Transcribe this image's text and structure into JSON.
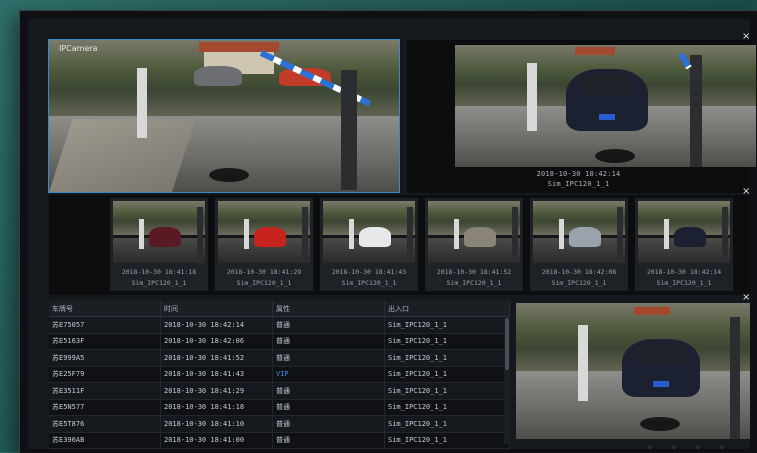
{
  "main_view": {
    "watermark": "IPCamera"
  },
  "snapshot_top": {
    "timestamp": "2018-10-30 18:42:14",
    "camera": "Sim_IPC120_1_1",
    "close_label": "×"
  },
  "thumbnails": [
    {
      "timestamp": "2018-10-30 18:41:18",
      "camera": "Sim_IPC120_1_1",
      "car_color": "#5a1a24"
    },
    {
      "timestamp": "2018-10-30 18:41:29",
      "camera": "Sim_IPC120_1_1",
      "car_color": "#c8241e"
    },
    {
      "timestamp": "2018-10-30 18:41:43",
      "camera": "Sim_IPC120_1_1",
      "car_color": "#e6e8ea"
    },
    {
      "timestamp": "2018-10-30 18:41:52",
      "camera": "Sim_IPC120_1_1",
      "car_color": "#8a8478"
    },
    {
      "timestamp": "2018-10-30 18:42:08",
      "camera": "Sim_IPC120_1_1",
      "car_color": "#9aa2ac"
    },
    {
      "timestamp": "2018-10-30 18:42:14",
      "camera": "Sim_IPC120_1_1",
      "car_color": "#1b2130"
    }
  ],
  "thumb_close_label": "×",
  "table": {
    "headers": [
      "车牌号",
      "时间",
      "属性",
      "出入口"
    ],
    "rows": [
      [
        "苏E75057",
        "2018-10-30 18:42:14",
        "普通",
        "Sim_IPC120_1_1"
      ],
      [
        "苏E5163F",
        "2018-10-30 18:42:06",
        "普通",
        "Sim_IPC120_1_1"
      ],
      [
        "苏E999A5",
        "2018-10-30 18:41:52",
        "普通",
        "Sim_IPC120_1_1"
      ],
      [
        "苏E25F79",
        "2018-10-30 18:41:43",
        "VIP",
        "Sim_IPC120_1_1"
      ],
      [
        "苏E3511F",
        "2018-10-30 18:41:29",
        "普通",
        "Sim_IPC120_1_1"
      ],
      [
        "苏E5N577",
        "2018-10-30 18:41:18",
        "普通",
        "Sim_IPC120_1_1"
      ],
      [
        "苏E5T876",
        "2018-10-30 18:41:10",
        "普通",
        "Sim_IPC120_1_1"
      ],
      [
        "苏E390AB",
        "2018-10-30 18:41:00",
        "普通",
        "Sim_IPC120_1_1"
      ]
    ]
  },
  "colors": {
    "selection": "#3e86c7",
    "vip_text": "#3a8ee6",
    "plate_blue": "#2a5bd0"
  }
}
